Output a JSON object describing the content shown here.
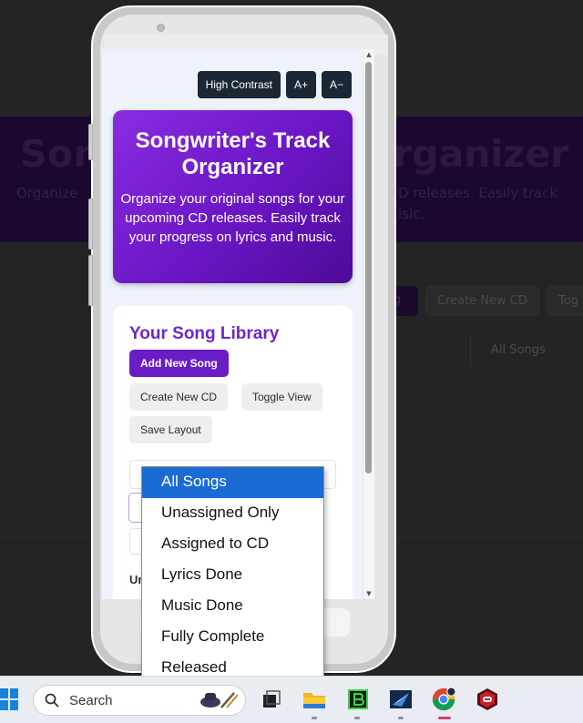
{
  "background_page": {
    "title_left": "Son",
    "title_right": "rganizer",
    "subtitle_left": "Organize",
    "subtitle_right_line1": "D releases. Easily track",
    "subtitle_right_line2": "isic.",
    "add_song_fragment": "g",
    "create_cd": "Create New CD",
    "toggle_fragment": "Tog",
    "filter_value": "All Songs"
  },
  "toolbar": {
    "high_contrast": "High Contrast",
    "font_increase": "A+",
    "font_decrease": "A−"
  },
  "hero": {
    "title": "Songwriter's Track Organizer",
    "description": "Organize your original songs for your upcoming CD releases. Easily track your progress on lyrics and music."
  },
  "library": {
    "title": "Your Song Library",
    "add_song": "Add New Song",
    "create_cd": "Create New CD",
    "toggle_view": "Toggle View",
    "save_layout": "Save Layout",
    "partial_label": "Ur"
  },
  "filter_dropdown": {
    "selected": "All Songs",
    "options": [
      "All Songs",
      "Unassigned Only",
      "Assigned to CD",
      "Lyrics Done",
      "Music Done",
      "Fully Complete",
      "Released"
    ]
  },
  "taskbar": {
    "search_placeholder": "Search"
  },
  "colors": {
    "accent": "#6a1dc6",
    "dropdown_highlight": "#1a6bd4",
    "toolbar_button": "#1c2735"
  }
}
